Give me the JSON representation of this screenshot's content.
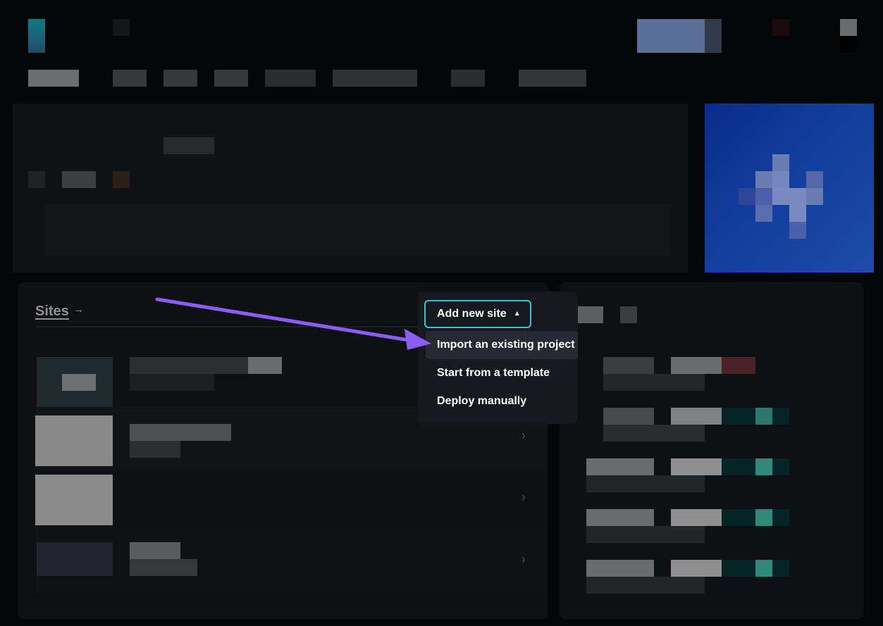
{
  "sites_panel": {
    "title": "Sites",
    "arrow_glyph": "→",
    "row_chevron": "›"
  },
  "add_site_menu": {
    "button_label": "Add new site",
    "items": [
      {
        "label": "Import an existing project"
      },
      {
        "label": "Start from a template"
      },
      {
        "label": "Deploy manually"
      }
    ]
  },
  "colors": {
    "accent_border": "#30c8c9",
    "annotation_arrow": "#8b5cf6"
  }
}
